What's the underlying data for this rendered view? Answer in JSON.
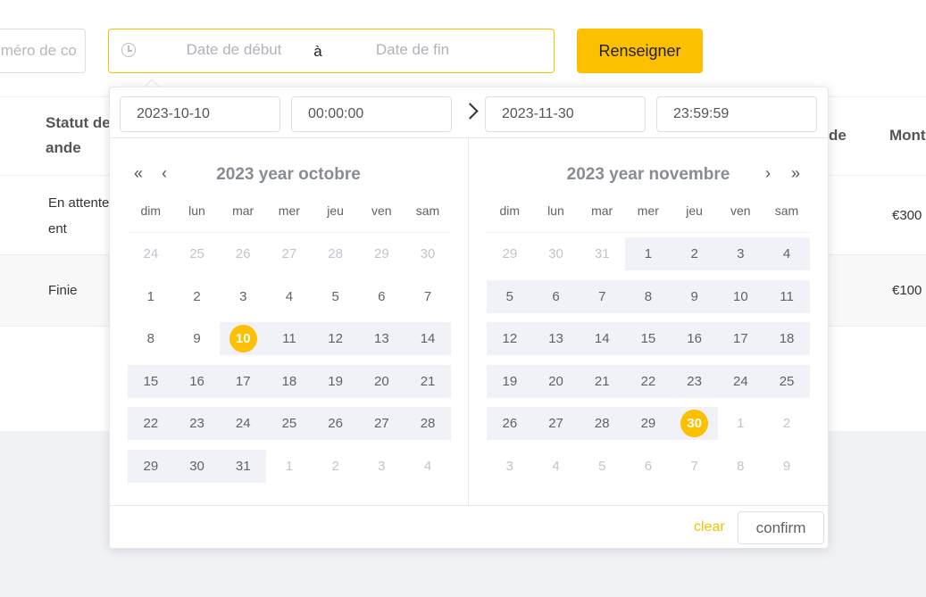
{
  "filters": {
    "order_placeholder": "Numéro de commande",
    "start_placeholder": "Date de début",
    "separator": "à",
    "end_placeholder": "Date de fin",
    "fill_button": "Renseigner"
  },
  "table": {
    "headers": [
      "Statut de la commande",
      "de",
      "Mont"
    ],
    "status_header_line1": "Statut de",
    "status_header_line2": "ande",
    "rows": [
      {
        "status_line1": "En attente",
        "status_line2": "ent",
        "amount": "€300"
      },
      {
        "status": "Finie",
        "amount": "€100"
      }
    ]
  },
  "picker": {
    "start_date": "2023-10-10",
    "start_time": "00:00:00",
    "end_date": "2023-11-30",
    "end_time": "23:59:59",
    "weekdays": [
      "dim",
      "lun",
      "mar",
      "mer",
      "jeu",
      "ven",
      "sam"
    ],
    "left": {
      "title": "2023 year octobre",
      "weeks": [
        [
          {
            "d": "24",
            "m": 1
          },
          {
            "d": "25",
            "m": 1
          },
          {
            "d": "26",
            "m": 1
          },
          {
            "d": "27",
            "m": 1
          },
          {
            "d": "28",
            "m": 1
          },
          {
            "d": "29",
            "m": 1
          },
          {
            "d": "30",
            "m": 1
          }
        ],
        [
          {
            "d": "1"
          },
          {
            "d": "2"
          },
          {
            "d": "3"
          },
          {
            "d": "4"
          },
          {
            "d": "5"
          },
          {
            "d": "6"
          },
          {
            "d": "7"
          }
        ],
        [
          {
            "d": "8"
          },
          {
            "d": "9"
          },
          {
            "d": "10",
            "s": 1
          },
          {
            "d": "11"
          },
          {
            "d": "12"
          },
          {
            "d": "13"
          },
          {
            "d": "14"
          }
        ],
        [
          {
            "d": "15"
          },
          {
            "d": "16"
          },
          {
            "d": "17"
          },
          {
            "d": "18"
          },
          {
            "d": "19"
          },
          {
            "d": "20"
          },
          {
            "d": "21"
          }
        ],
        [
          {
            "d": "22"
          },
          {
            "d": "23"
          },
          {
            "d": "24"
          },
          {
            "d": "25"
          },
          {
            "d": "26"
          },
          {
            "d": "27"
          },
          {
            "d": "28"
          }
        ],
        [
          {
            "d": "29"
          },
          {
            "d": "30"
          },
          {
            "d": "31"
          },
          {
            "d": "1",
            "m": 1
          },
          {
            "d": "2",
            "m": 1
          },
          {
            "d": "3",
            "m": 1
          },
          {
            "d": "4",
            "m": 1
          }
        ]
      ],
      "bands": [
        [],
        [],
        [
          2,
          7
        ],
        [
          0,
          7
        ],
        [
          0,
          7
        ],
        [
          0,
          3
        ]
      ]
    },
    "right": {
      "title": "2023 year novembre",
      "weeks": [
        [
          {
            "d": "29",
            "m": 1
          },
          {
            "d": "30",
            "m": 1
          },
          {
            "d": "31",
            "m": 1
          },
          {
            "d": "1"
          },
          {
            "d": "2"
          },
          {
            "d": "3"
          },
          {
            "d": "4"
          }
        ],
        [
          {
            "d": "5"
          },
          {
            "d": "6"
          },
          {
            "d": "7"
          },
          {
            "d": "8"
          },
          {
            "d": "9"
          },
          {
            "d": "10"
          },
          {
            "d": "11"
          }
        ],
        [
          {
            "d": "12"
          },
          {
            "d": "13"
          },
          {
            "d": "14"
          },
          {
            "d": "15"
          },
          {
            "d": "16"
          },
          {
            "d": "17"
          },
          {
            "d": "18"
          }
        ],
        [
          {
            "d": "19"
          },
          {
            "d": "20"
          },
          {
            "d": "21"
          },
          {
            "d": "22"
          },
          {
            "d": "23"
          },
          {
            "d": "24"
          },
          {
            "d": "25"
          }
        ],
        [
          {
            "d": "26"
          },
          {
            "d": "27"
          },
          {
            "d": "28"
          },
          {
            "d": "29"
          },
          {
            "d": "30",
            "s": 1
          },
          {
            "d": "1",
            "m": 1
          },
          {
            "d": "2",
            "m": 1
          }
        ],
        [
          {
            "d": "3",
            "m": 1
          },
          {
            "d": "4",
            "m": 1
          },
          {
            "d": "5",
            "m": 1
          },
          {
            "d": "6",
            "m": 1
          },
          {
            "d": "7",
            "m": 1
          },
          {
            "d": "8",
            "m": 1
          },
          {
            "d": "9",
            "m": 1
          }
        ]
      ],
      "bands": [
        [
          3,
          7
        ],
        [
          0,
          7
        ],
        [
          0,
          7
        ],
        [
          0,
          7
        ],
        [
          0,
          5
        ],
        []
      ]
    },
    "nav_icons": [
      "double-chevron-left-icon",
      "chevron-left-icon",
      "chevron-right-icon",
      "double-chevron-right-icon"
    ],
    "clear_label": "clear",
    "confirm_label": "confirm",
    "colors": {
      "accent": "#fdc000",
      "range_band": "#f0f2f8",
      "muted_day": "#c0c4cc"
    }
  }
}
